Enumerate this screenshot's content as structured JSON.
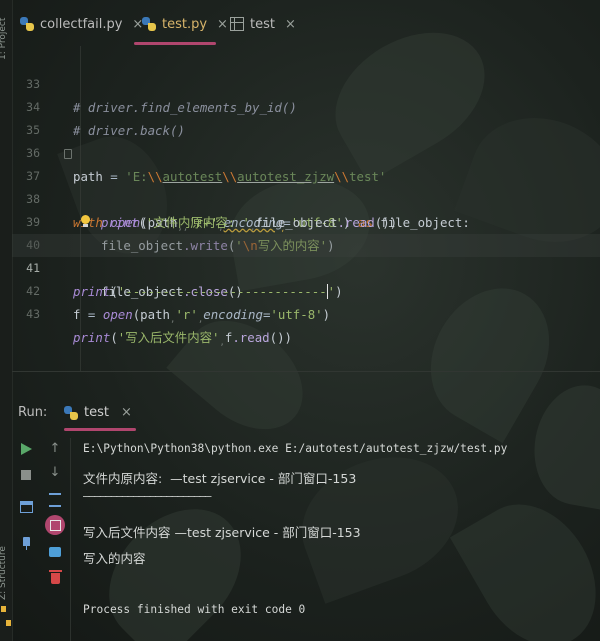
{
  "left_strip": {
    "top_label": "1: Project",
    "bottom_label": "Z: Structure"
  },
  "tabs": [
    {
      "label": "collectfail.py",
      "active": false
    },
    {
      "label": "test.py",
      "active": true
    },
    {
      "label": "test",
      "active": false
    }
  ],
  "editor": {
    "lines": [
      {
        "num": "33"
      },
      {
        "num": "34"
      },
      {
        "num": "35"
      },
      {
        "num": "36"
      },
      {
        "num": "37"
      },
      {
        "num": "38"
      },
      {
        "num": "39"
      },
      {
        "num": "40"
      },
      {
        "num": "41"
      },
      {
        "num": "42"
      },
      {
        "num": "43"
      }
    ],
    "l33": "# driver.find_elements_by_id()",
    "l34": "# driver.back()",
    "l36": {
      "var": "path",
      "eq": " = ",
      "q1": "'E:",
      "e1": "\\\\",
      "p1": "autotest",
      "e2": "\\\\",
      "p2": "autotest_zjzw",
      "e3": "\\\\",
      "p3": "test'"
    },
    "l37": {
      "kw": "with",
      "fn": "open",
      "a1": "(path",
      "a2": "'r+'",
      "param": "encoding",
      "eq": "=",
      "enc": "'utf-8'",
      "close": ")",
      "as": "as",
      "obj": "file_object:"
    },
    "l38": {
      "fn": "print",
      "open": "(",
      "s": "'文件内原内容: '",
      "obj": "file_object",
      "meth": ".read",
      "tail": "())"
    },
    "l39": {
      "obj": "file_object",
      "meth": ".write",
      "open": "(",
      "q": "'",
      "esc": "\\n",
      "s": "写入的内容'",
      "close": ")"
    },
    "l40": {
      "obj": "file_object",
      "meth": ".close",
      "tail": "()"
    },
    "l41": {
      "fn": "print",
      "open": "(",
      "s": "'---------------------------",
      "s2": "'",
      "close": ")"
    },
    "l42": {
      "var": "f",
      "eq": " = ",
      "fn": "open",
      "a1": "(path",
      "a2": "'r'",
      "param": "encoding",
      "eq2": "=",
      "enc": "'utf-8'",
      "close": ")"
    },
    "l43": {
      "fn": "print",
      "open": "(",
      "s": "'写入后文件内容'",
      "obj": "f",
      "meth": ".read",
      "tail": "())"
    }
  },
  "run": {
    "label": "Run:",
    "tab": "test",
    "close": "×"
  },
  "console": {
    "cmd": "E:\\Python\\Python38\\python.exe E:/autotest/autotest_zjzw/test.py",
    "out1": "文件内原内容:  —test zjservice - 部门窗口-153",
    "dash": "———————————————————————",
    "out2": "写入后文件内容 —test zjservice - 部门窗口-153",
    "out3": "写入的内容",
    "exit": "Process finished with exit code 0"
  },
  "icons": {
    "python_file": "python-file-icon",
    "text_file": "text-file-icon",
    "bulb": "lightbulb-icon",
    "run": "play-icon",
    "stop": "stop-icon",
    "restore": "restore-layout-icon",
    "pin": "pin-icon",
    "up": "arrow-up-icon",
    "down": "arrow-down-icon",
    "wrap": "soft-wrap-icon",
    "scroll_end": "scroll-to-end-icon",
    "print": "print-icon",
    "trash": "trash-icon"
  },
  "colors": {
    "keyword": "#cc7832",
    "string": "#6a8759",
    "function": "#a98bd6",
    "comment": "#8a8f9d",
    "accent": "#b0466e",
    "active_tab": "#d7b46a"
  }
}
